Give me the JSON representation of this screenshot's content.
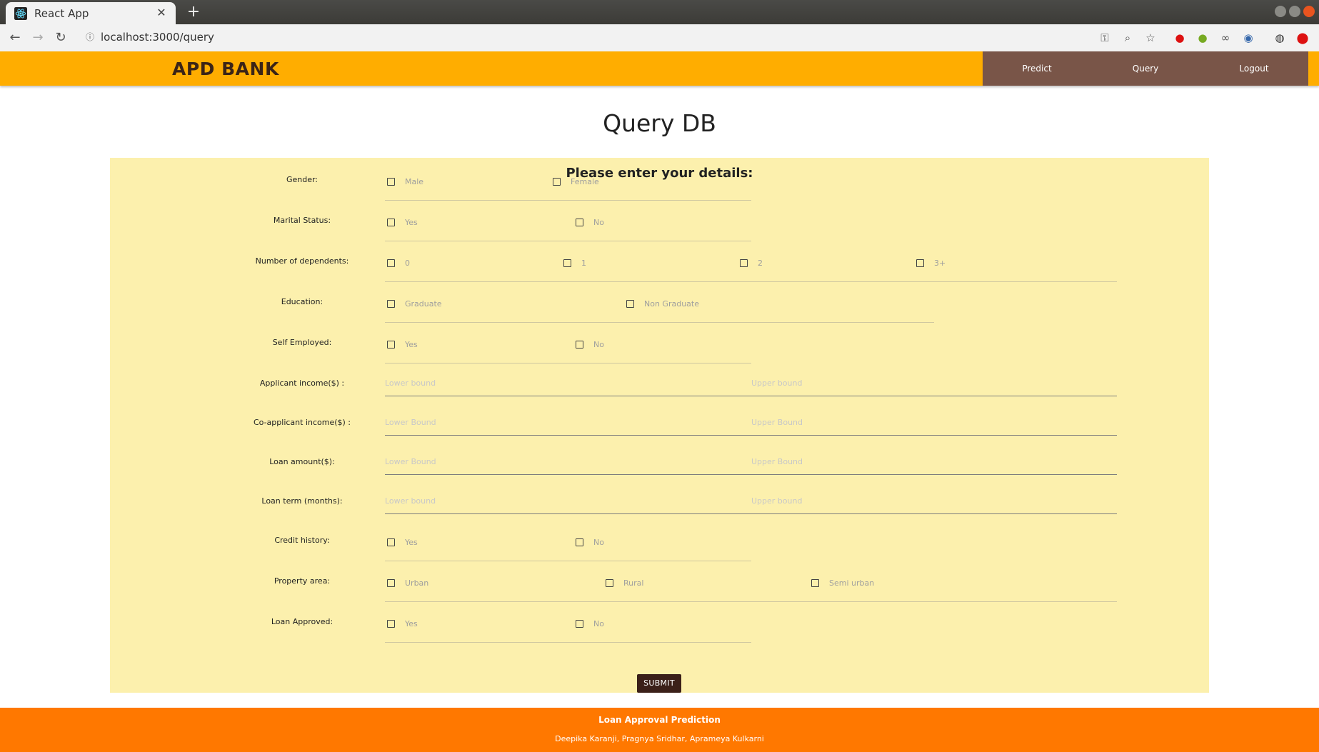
{
  "browser": {
    "tab_title": "React App",
    "url": "localhost:3000/query"
  },
  "header": {
    "brand": "APD BANK",
    "nav": [
      "Predict",
      "Query",
      "Logout"
    ]
  },
  "page_title": "Query DB",
  "form": {
    "heading": "Please enter your details:",
    "gender": {
      "label": "Gender:",
      "options": [
        "Male",
        "Female"
      ]
    },
    "marital": {
      "label": "Marital Status:",
      "options": [
        "Yes",
        "No"
      ]
    },
    "dependents": {
      "label": "Number of dependents:",
      "options": [
        "0",
        "1",
        "2",
        "3+"
      ]
    },
    "education": {
      "label": "Education:",
      "options": [
        "Graduate",
        "Non Graduate"
      ]
    },
    "self_employed": {
      "label": "Self Employed:",
      "options": [
        "Yes",
        "No"
      ]
    },
    "applicant_income": {
      "label": "Applicant income($) :",
      "lower": "Lower bound",
      "upper": "Upper bound"
    },
    "coapplicant_income": {
      "label": "Co-applicant income($) :",
      "lower": "Lower Bound",
      "upper": "Upper Bound"
    },
    "loan_amount": {
      "label": "Loan amount($):",
      "lower": "Lower Bound",
      "upper": "Upper Bound"
    },
    "loan_term": {
      "label": "Loan term (months):",
      "lower": "Lower bound",
      "upper": "Upper bound"
    },
    "credit_history": {
      "label": "Credit history:",
      "options": [
        "Yes",
        "No"
      ]
    },
    "property_area": {
      "label": "Property area:",
      "options": [
        "Urban",
        "Rural",
        "Semi urban"
      ]
    },
    "loan_approved": {
      "label": "Loan Approved:",
      "options": [
        "Yes",
        "No"
      ]
    },
    "submit": "SUBMIT"
  },
  "footer": {
    "title": "Loan Approval Prediction",
    "authors": "Deepika Karanji, Pragnya Sridhar, Aprameya Kulkarni"
  },
  "colors": {
    "header_bg": "#ffad00",
    "menu_bg": "#795548",
    "panel_bg": "#fcf0ad",
    "footer_bg": "#ff7800",
    "submit_bg": "#3b2019"
  }
}
